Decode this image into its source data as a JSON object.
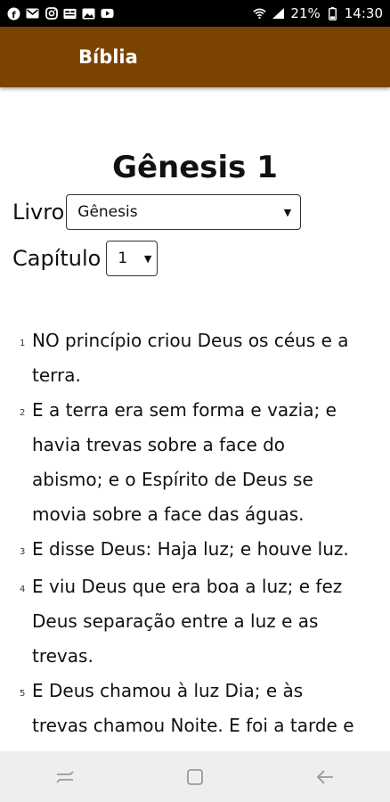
{
  "status_bar": {
    "battery": "21%",
    "time": "14:30",
    "left_icons": [
      "facebook-icon",
      "gmail-icon",
      "instagram-icon",
      "news-icon",
      "gallery-icon",
      "youtube-icon"
    ],
    "right_icons": [
      "wifi-icon",
      "signal-icon",
      "battery-icon"
    ]
  },
  "app_bar": {
    "title": "Bíblia",
    "background": "#7a4300"
  },
  "main": {
    "heading": "Gênesis 1",
    "book_label": "Livro",
    "book_value": "Gênesis",
    "chapter_label": "Capítulo",
    "chapter_value": "1",
    "verses": [
      {
        "num": "1",
        "text": "NO princípio criou Deus os céus e a terra."
      },
      {
        "num": "2",
        "text": "E a terra era sem forma e vazia; e havia trevas sobre a face do abismo; e o Espírito de Deus se movia sobre a face das águas."
      },
      {
        "num": "3",
        "text": "E disse Deus: Haja luz; e houve luz."
      },
      {
        "num": "4",
        "text": "E viu Deus que era boa a luz; e fez Deus separação entre a luz e as trevas."
      },
      {
        "num": "5",
        "text": "E Deus chamou à luz Dia; e às trevas chamou Noite. E foi a tarde e a manhã, o dia primeiro."
      }
    ]
  },
  "nav_bar": {
    "buttons": [
      "recent-apps-icon",
      "home-icon",
      "back-icon"
    ]
  }
}
